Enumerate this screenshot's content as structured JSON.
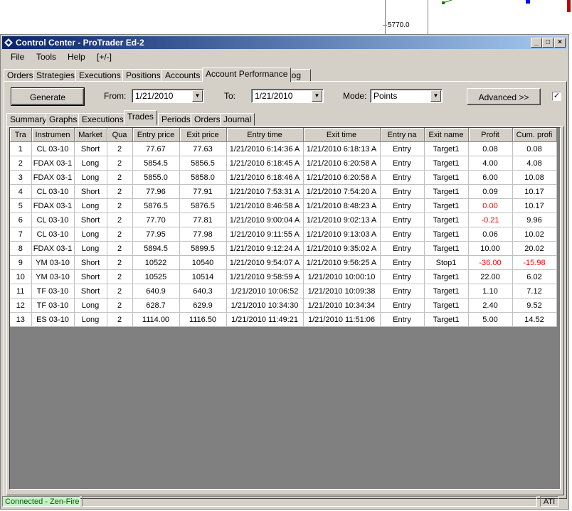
{
  "background_chart": {
    "price_label": "5770.0"
  },
  "window": {
    "title": "Control Center - ProTrader Ed-2"
  },
  "menu": [
    "File",
    "Tools",
    "Help",
    "[+/-]"
  ],
  "main_tabs": [
    "Orders",
    "Strategies",
    "Executions",
    "Positions",
    "Accounts",
    "Account Performance",
    "Log"
  ],
  "main_tabs_active": "Account Performance",
  "controls": {
    "generate_label": "Generate",
    "from_label": "From:",
    "from_value": "1/21/2010",
    "to_label": "To:",
    "to_value": "1/21/2010",
    "mode_label": "Mode:",
    "mode_value": "Points",
    "advanced_label": "Advanced >>",
    "checkbox_checked": true
  },
  "sub_tabs": [
    "Summary",
    "Graphs",
    "Executions",
    "Trades",
    "Periods",
    "Orders",
    "Journal"
  ],
  "sub_tabs_active": "Trades",
  "table": {
    "columns": [
      "Tra",
      "Instrumen",
      "Market",
      "Qua",
      "Entry price",
      "Exit price",
      "Entry time",
      "Exit time",
      "Entry na",
      "Exit name",
      "Profit",
      "Cum. profi"
    ],
    "rows": [
      [
        "1",
        "CL 03-10",
        "Short",
        "2",
        "77.67",
        "77.63",
        "1/21/2010 6:14:36 A",
        "1/21/2010 6:18:13 A",
        "Entry",
        "Target1",
        "0.08",
        "0.08"
      ],
      [
        "2",
        "FDAX 03-1",
        "Long",
        "2",
        "5854.5",
        "5856.5",
        "1/21/2010 6:18:45 A",
        "1/21/2010 6:20:58 A",
        "Entry",
        "Target1",
        "4.00",
        "4.08"
      ],
      [
        "3",
        "FDAX 03-1",
        "Long",
        "2",
        "5855.0",
        "5858.0",
        "1/21/2010 6:18:46 A",
        "1/21/2010 6:20:58 A",
        "Entry",
        "Target1",
        "6.00",
        "10.08"
      ],
      [
        "4",
        "CL 03-10",
        "Short",
        "2",
        "77.96",
        "77.91",
        "1/21/2010 7:53:31 A",
        "1/21/2010 7:54:20 A",
        "Entry",
        "Target1",
        "0.09",
        "10.17"
      ],
      [
        "5",
        "FDAX 03-1",
        "Long",
        "2",
        "5876.5",
        "5876.5",
        "1/21/2010 8:46:58 A",
        "1/21/2010 8:48:23 A",
        "Entry",
        "Target1",
        "0.00",
        "10.17"
      ],
      [
        "6",
        "CL 03-10",
        "Short",
        "2",
        "77.70",
        "77.81",
        "1/21/2010 9:00:04 A",
        "1/21/2010 9:02:13 A",
        "Entry",
        "Target1",
        "-0.21",
        "9.96"
      ],
      [
        "7",
        "CL 03-10",
        "Long",
        "2",
        "77.95",
        "77.98",
        "1/21/2010 9:11:55 A",
        "1/21/2010 9:13:03 A",
        "Entry",
        "Target1",
        "0.06",
        "10.02"
      ],
      [
        "8",
        "FDAX 03-1",
        "Long",
        "2",
        "5894.5",
        "5899.5",
        "1/21/2010 9:12:24 A",
        "1/21/2010 9:35:02 A",
        "Entry",
        "Target1",
        "10.00",
        "20.02"
      ],
      [
        "9",
        "YM 03-10",
        "Short",
        "2",
        "10522",
        "10540",
        "1/21/2010 9:54:07 A",
        "1/21/2010 9:56:25 A",
        "Entry",
        "Stop1",
        "-36.00",
        "-15.98"
      ],
      [
        "10",
        "YM 03-10",
        "Short",
        "2",
        "10525",
        "10514",
        "1/21/2010 9:58:59 A",
        "1/21/2010 10:00:10",
        "Entry",
        "Target1",
        "22.00",
        "6.02"
      ],
      [
        "11",
        "TF 03-10",
        "Short",
        "2",
        "640.9",
        "640.3",
        "1/21/2010 10:06:52",
        "1/21/2010 10:09:38",
        "Entry",
        "Target1",
        "1.10",
        "7.12"
      ],
      [
        "12",
        "TF 03-10",
        "Long",
        "2",
        "628.7",
        "629.9",
        "1/21/2010 10:34:30",
        "1/21/2010 10:34:34",
        "Entry",
        "Target1",
        "2.40",
        "9.52"
      ],
      [
        "13",
        "ES 03-10",
        "Long",
        "2",
        "1114.00",
        "1116.50",
        "1/21/2010 11:49:21",
        "1/21/2010 11:51:06",
        "Entry",
        "Target1",
        "5.00",
        "14.52"
      ]
    ],
    "negative_color": "#ff0000"
  },
  "status": {
    "connection": "Connected - Zen-Fire",
    "right": "ATI"
  }
}
